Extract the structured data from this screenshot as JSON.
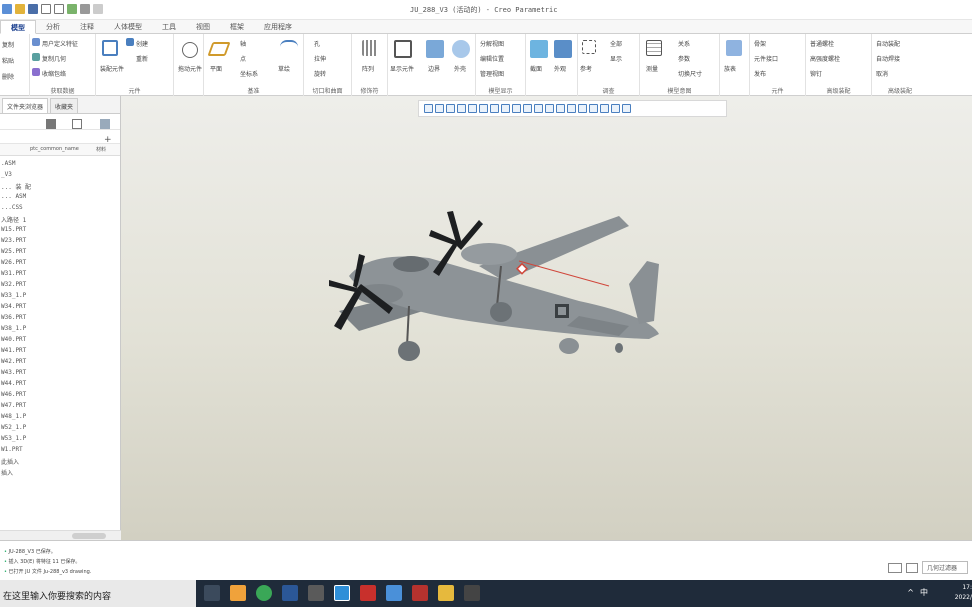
{
  "title": "JU_288_V3 (活动的) - Creo Parametric",
  "ribbon_tabs": [
    "模型",
    "分析",
    "注释",
    "人体模型",
    "工具",
    "视图",
    "框架",
    "应用程序"
  ],
  "ribbon": {
    "group1": {
      "items": [
        "复制",
        "粘贴",
        "删除"
      ],
      "label": "获取数据"
    },
    "group2": {
      "items": [
        "用户定义特征",
        "复制几何",
        "收缩包络"
      ],
      "label": "获取数据"
    },
    "group3": {
      "items": [
        "创建",
        "重新",
        "装配元件"
      ],
      "label": "元件"
    },
    "group4": {
      "items": [
        "拖动元件"
      ],
      "label": ""
    },
    "group5": {
      "items": [
        "平面",
        "轴",
        "点",
        "坐标系",
        "草绘"
      ],
      "label": "基准"
    },
    "group6": {
      "items": [
        "孔",
        "拉伸",
        "旋转"
      ],
      "label": "切口和曲面"
    },
    "group7": {
      "items": [
        "阵列"
      ],
      "label": "修饰符"
    },
    "group8": {
      "items": [
        "显示元件",
        "边界",
        "外壳"
      ],
      "label": "模型显示"
    },
    "group9": {
      "items": [
        "分解视图",
        "编辑位置",
        "管理视图"
      ],
      "label": "模型显示"
    },
    "group10": {
      "items": [
        "截面",
        "外观"
      ],
      "label": ""
    },
    "group11": {
      "items": [
        "参考",
        "全部",
        "显示"
      ],
      "label": "调查"
    },
    "group12": {
      "items": [
        "测量",
        "关系",
        "参数",
        "切换尺寸"
      ],
      "label": "模型意图"
    },
    "group13": {
      "items": [
        "族表",
        "创建"
      ],
      "label": ""
    },
    "group14": {
      "items": [
        "骨架",
        "元件接口",
        "发布"
      ],
      "label": "元件"
    },
    "group15": {
      "items": [
        "普通螺栓",
        "高强度螺栓",
        "铆钉"
      ],
      "label": "高级装配"
    },
    "group16": {
      "items": [
        "自动装配",
        "自动焊接",
        "取消"
      ],
      "label": "高级装配"
    },
    "label_a": "获取数据",
    "label_b": "元件",
    "label_c": "基准",
    "label_d": "切口和曲面",
    "label_e": "修饰符",
    "label_f": "模型显示",
    "label_g": "调查",
    "label_h": "模型意图",
    "label_i": "元件",
    "label_j": "高级装配"
  },
  "left_panel": {
    "tabs": [
      "文件夹浏览器",
      "收藏夹"
    ],
    "col_hdr1": "ptc_common_name",
    "col_hdr2": "材料",
    "tree_items": [
      ".ASM",
      "_V3",
      "... 装 配",
      "... ASM",
      "...CSS",
      "入路径 1",
      "W15.PRT",
      "W23.PRT",
      "W25.PRT",
      "W26.PRT",
      "W31.PRT",
      "W32.PRT",
      "W33_1.P",
      "W34.PRT",
      "W36.PRT",
      "W38_1.P",
      "W40.PRT",
      "W41.PRT",
      "W42.PRT",
      "W43.PRT",
      "W44.PRT",
      "W46.PRT",
      "W47.PRT",
      "W48_1.P",
      "W52_1.P",
      "W53_1.P",
      "W1.PRT",
      "此插入",
      "插入"
    ]
  },
  "messages": [
    "JU-288_V3 已保存。",
    "插入 3D(E) 将特征 11 已保存。",
    "已打开 JU 文件 Ju-288_v3 drawing."
  ],
  "status": {
    "filter": "几何过滤器"
  },
  "taskbar": {
    "search_placeholder": "在这里输入你要搜索的内容",
    "ime": "中",
    "clock_time": "17:",
    "clock_date": "2022/"
  },
  "colors": {
    "accent": "#1a3f8f",
    "viewport_top": "#eeeeea",
    "viewport_bottom": "#d2d0c2",
    "model": "#8a9094",
    "taskbar": "#1f2b3a"
  }
}
